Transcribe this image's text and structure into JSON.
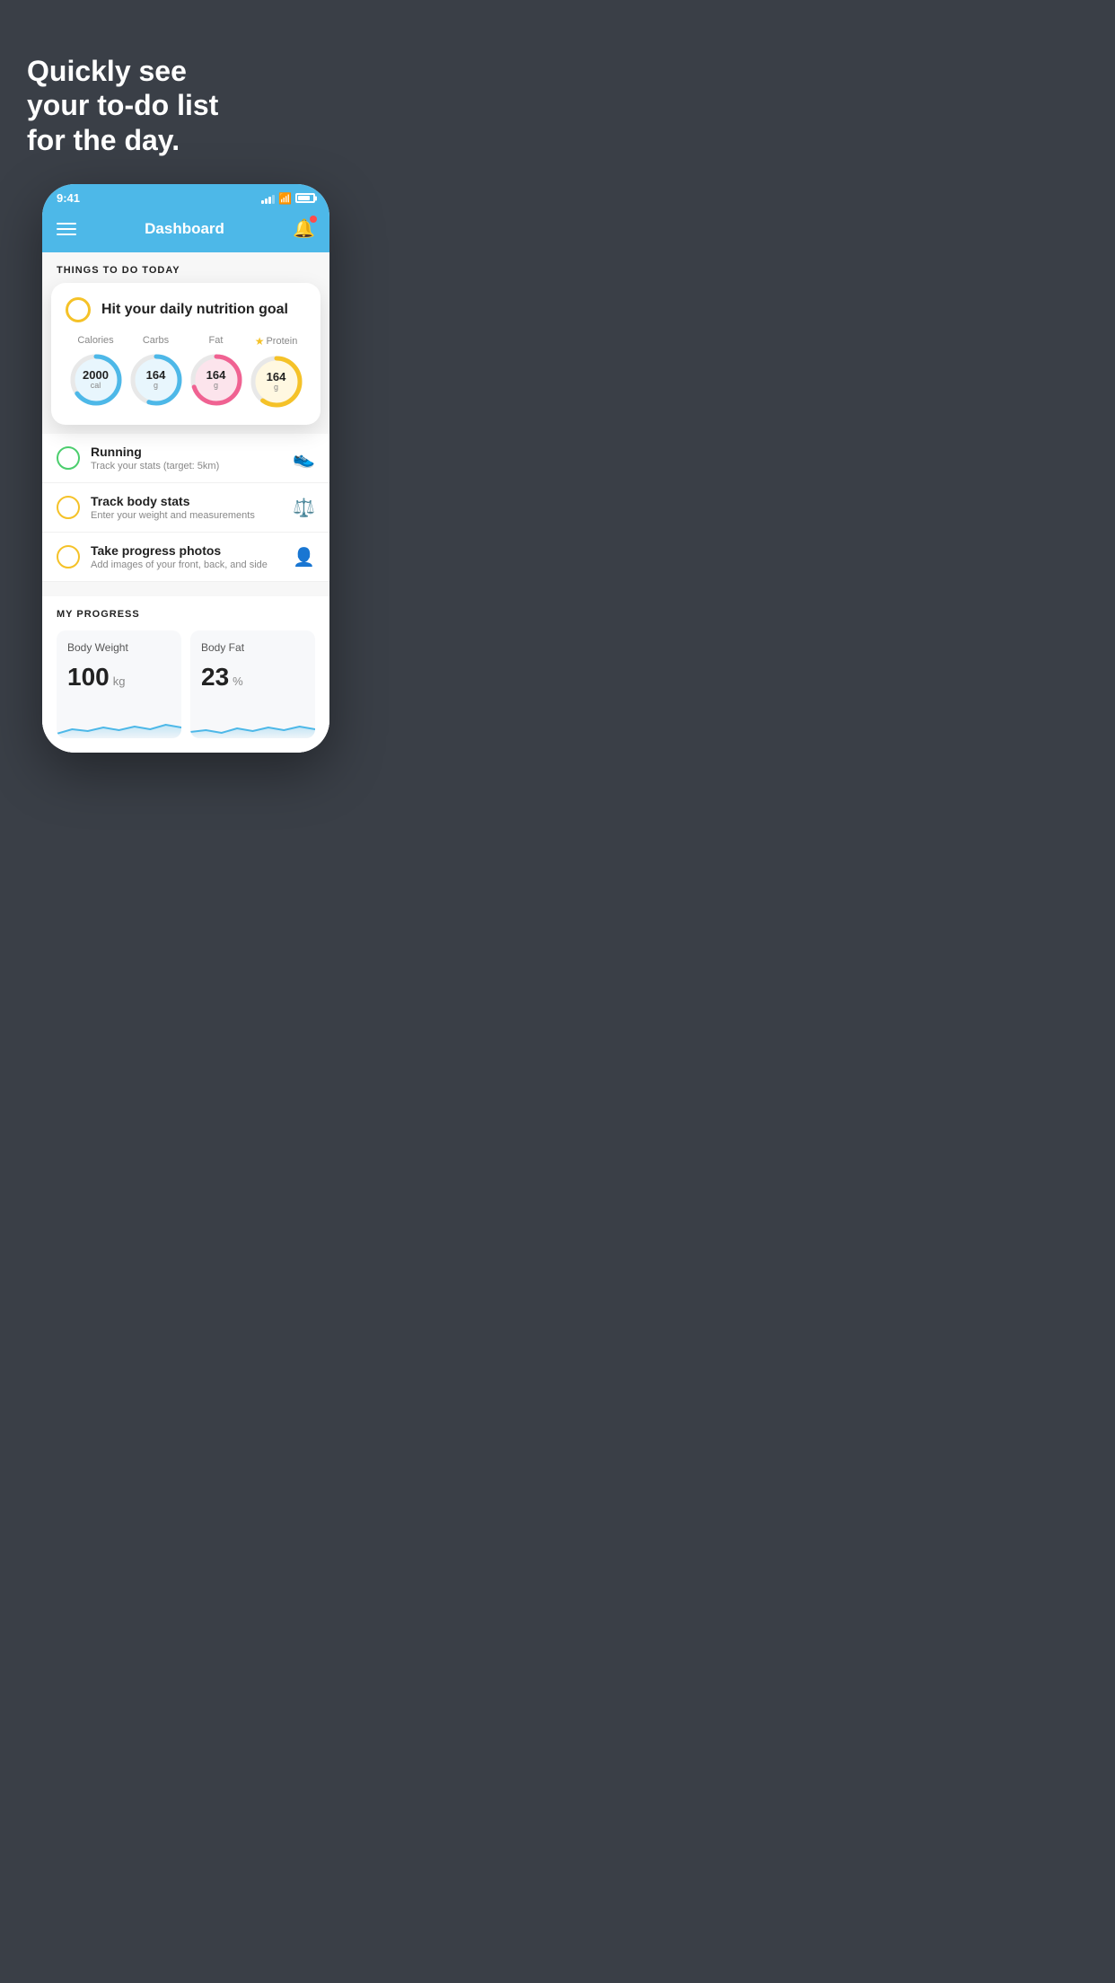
{
  "headline": {
    "line1": "Quickly see",
    "line2": "your to-do list",
    "line3": "for the day."
  },
  "status_bar": {
    "time": "9:41"
  },
  "nav": {
    "title": "Dashboard"
  },
  "section_header": "THINGS TO DO TODAY",
  "nutrition_card": {
    "title": "Hit your daily nutrition goal",
    "items": [
      {
        "label": "Calories",
        "value": "2000",
        "unit": "cal",
        "color_track": "#4db8e8",
        "color_bg": "#e8f6fd",
        "pct": 65
      },
      {
        "label": "Carbs",
        "value": "164",
        "unit": "g",
        "color_track": "#4db8e8",
        "color_bg": "#e8f6fd",
        "pct": 55
      },
      {
        "label": "Fat",
        "value": "164",
        "unit": "g",
        "color_track": "#f06292",
        "color_bg": "#fce4ec",
        "pct": 70
      },
      {
        "label": "Protein",
        "value": "164",
        "unit": "g",
        "color_track": "#f5c228",
        "color_bg": "#fff8e1",
        "pct": 60,
        "starred": true
      }
    ]
  },
  "todo_items": [
    {
      "title": "Running",
      "subtitle": "Track your stats (target: 5km)",
      "circle_color": "green",
      "icon": "👟"
    },
    {
      "title": "Track body stats",
      "subtitle": "Enter your weight and measurements",
      "circle_color": "yellow",
      "icon": "⚖️"
    },
    {
      "title": "Take progress photos",
      "subtitle": "Add images of your front, back, and side",
      "circle_color": "yellow",
      "icon": "👤"
    }
  ],
  "progress": {
    "section_title": "MY PROGRESS",
    "cards": [
      {
        "label": "Body Weight",
        "value": "100",
        "unit": "kg"
      },
      {
        "label": "Body Fat",
        "value": "23",
        "unit": "%"
      }
    ]
  }
}
